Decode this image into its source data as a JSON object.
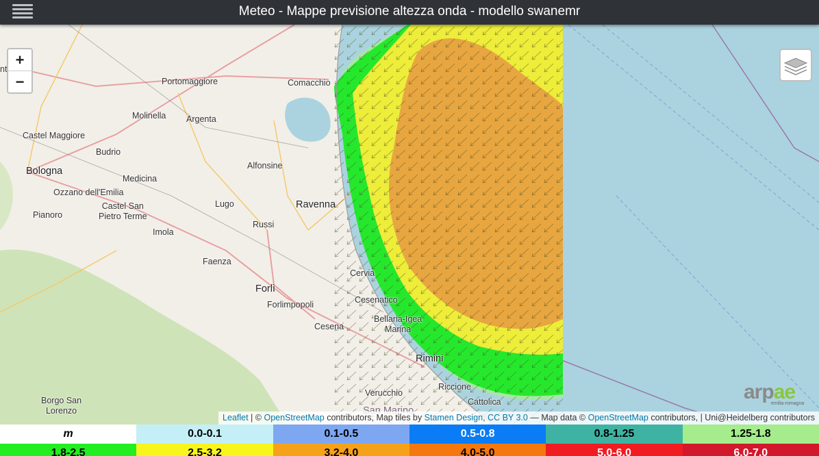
{
  "header": {
    "title": "Meteo - Mappe previsione altezza onda - modello swanemr",
    "menu_icon": "hamburger-menu-icon"
  },
  "zoom": {
    "in_label": "+",
    "out_label": "−"
  },
  "layers_icon": "layers-icon",
  "places": [
    {
      "id": "comacchio",
      "label": "Comacchio"
    },
    {
      "id": "portomaggiore",
      "label": "Portomaggiore"
    },
    {
      "id": "molinella",
      "label": "Molinella"
    },
    {
      "id": "argenta",
      "label": "Argenta"
    },
    {
      "id": "castel-maggiore",
      "label": "Castel Maggiore"
    },
    {
      "id": "budrio",
      "label": "Budrio"
    },
    {
      "id": "bologna",
      "label": "Bologna"
    },
    {
      "id": "alfonsine",
      "label": "Alfonsine"
    },
    {
      "id": "medicina",
      "label": "Medicina"
    },
    {
      "id": "ozzano",
      "label": "Ozzano dell'Emilia"
    },
    {
      "id": "lugo",
      "label": "Lugo"
    },
    {
      "id": "ravenna",
      "label": "Ravenna"
    },
    {
      "id": "castel-san-pietro",
      "label": "Castel San\nPietro Terme"
    },
    {
      "id": "pianoro",
      "label": "Pianoro"
    },
    {
      "id": "russi",
      "label": "Russi"
    },
    {
      "id": "imola",
      "label": "Imola"
    },
    {
      "id": "faenza",
      "label": "Faenza"
    },
    {
      "id": "cervia",
      "label": "Cervia"
    },
    {
      "id": "forli",
      "label": "Forlì"
    },
    {
      "id": "cesenatico",
      "label": "Cesenatico"
    },
    {
      "id": "forlimpopoli",
      "label": "Forlimpopoli"
    },
    {
      "id": "bellaria",
      "label": "Bellaria-Igea\nMarina"
    },
    {
      "id": "cesena",
      "label": "Cesena"
    },
    {
      "id": "rimini",
      "label": "Rimini"
    },
    {
      "id": "riccione",
      "label": "Riccione"
    },
    {
      "id": "verucchio",
      "label": "Verucchio"
    },
    {
      "id": "san-marino",
      "label": "San Marino"
    },
    {
      "id": "cattolica",
      "label": "Cattolica"
    },
    {
      "id": "borgo-san-lorenzo",
      "label": "Borgo San\nLorenzo"
    },
    {
      "id": "nto",
      "label": "nto"
    }
  ],
  "attribution": {
    "leaflet": "Leaflet",
    "sep1": " | © ",
    "osm1": "OpenStreetMap",
    "text1": " contributors, Map tiles by ",
    "stamen": "Stamen Design",
    "comma": ", ",
    "ccby": "CC BY 3.0",
    "text2": " — Map data © ",
    "osm2": "OpenStreetMap",
    "text3": " contributors, | Uni@Heidelberg contributors"
  },
  "logo": {
    "text_grey": "arp",
    "text_green": "ae",
    "sub": "emilia-romagna"
  },
  "legend": {
    "unit": "m",
    "row1": [
      {
        "label": "0.0-0.1",
        "color": "#c4eff7"
      },
      {
        "label": "0.1-0.5",
        "color": "#7ea7f2"
      },
      {
        "label": "0.5-0.8",
        "color": "#0a7cf5"
      },
      {
        "label": "0.8-1.25",
        "color": "#3eb3a3"
      },
      {
        "label": "1.25-1.8",
        "color": "#a4ec8c"
      }
    ],
    "row2": [
      {
        "label": "1.8-2.5",
        "color": "#22ee22"
      },
      {
        "label": "2.5-3.2",
        "color": "#f7f51c"
      },
      {
        "label": "3.2-4.0",
        "color": "#f5a21a"
      },
      {
        "label": "4.0-5.0",
        "color": "#f5780f"
      },
      {
        "label": "5.0-6.0",
        "color": "#f01c21"
      },
      {
        "label": "6.0-7.0",
        "color": "#d2182b"
      }
    ]
  },
  "wave_colors": {
    "band_1_8": "#25e82d",
    "band_2_5": "#eded3a",
    "band_3_2": "#e8a640",
    "band_1_25": "#a7e7a4",
    "sea": "#aad3df"
  }
}
